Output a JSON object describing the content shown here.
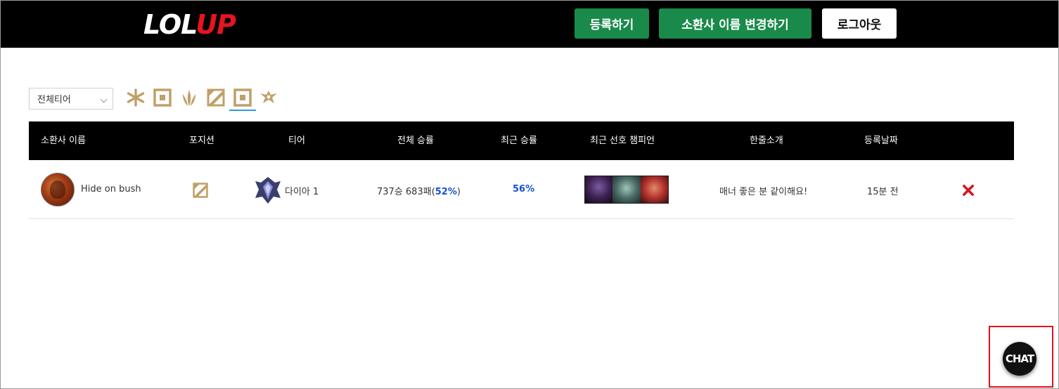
{
  "header": {
    "logo_part1": "LOL",
    "logo_part2": "UP",
    "register_label": "등록하기",
    "rename_label": "소환사 이름 변경하기",
    "logout_label": "로그아웃"
  },
  "filter": {
    "tier_select_value": "전체티어",
    "positions": [
      "top-icon",
      "jungle-icon",
      "mid-icon",
      "bottom-icon",
      "support-icon",
      "all-positions-icon"
    ],
    "selected_position": "support-icon"
  },
  "table": {
    "columns": [
      "소환사 이름",
      "포지션",
      "티어",
      "전체 승률",
      "최근 승률",
      "최근 선호 챔피언",
      "한줄소개",
      "등록날짜"
    ],
    "rows": [
      {
        "summoner": "Hide on bush",
        "position_icon": "mid-icon",
        "tier": "다이아 1",
        "total_record": "737승 683패",
        "total_winrate_open": "(",
        "total_winrate": "52%",
        "total_winrate_close": ")",
        "recent_winrate": "56%",
        "champions": [
          "champion-1",
          "champion-2",
          "champion-3"
        ],
        "intro": "매너 좋은 분 같이해요!",
        "registered": "15분 전"
      }
    ]
  },
  "chat": {
    "label": "CHAT"
  },
  "colors": {
    "gold": "#c0a06a",
    "green": "#1a8a4a",
    "blue": "#1652d6",
    "red": "#e0131c"
  }
}
